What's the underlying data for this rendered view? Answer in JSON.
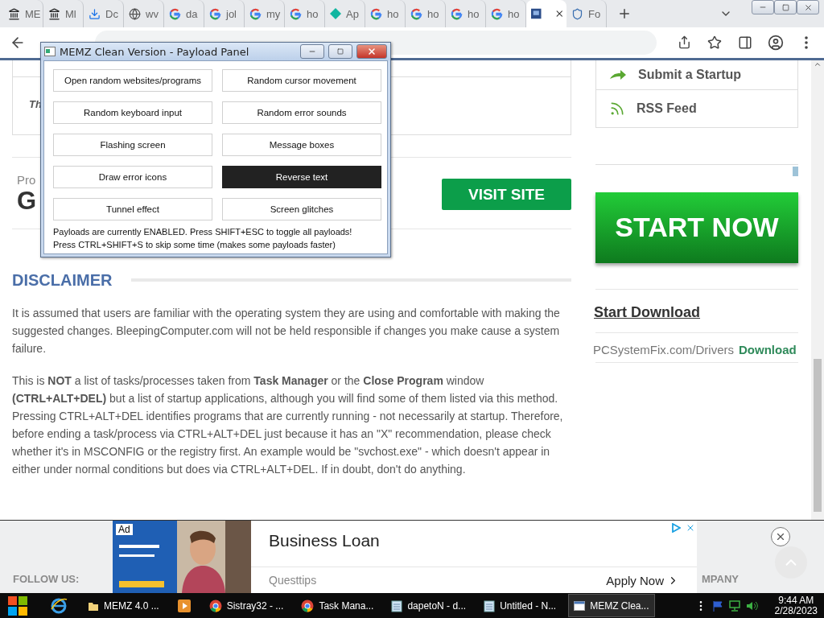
{
  "browser": {
    "tabs": [
      {
        "label": "ME",
        "kind": "museum",
        "selected": false
      },
      {
        "label": "Ml",
        "kind": "museum",
        "selected": false
      },
      {
        "label": "Dc",
        "kind": "download",
        "selected": false
      },
      {
        "label": "wv",
        "kind": "globe",
        "selected": false
      },
      {
        "label": "da",
        "kind": "google",
        "selected": false
      },
      {
        "label": "jol",
        "kind": "google",
        "selected": false
      },
      {
        "label": "my",
        "kind": "google",
        "selected": false
      },
      {
        "label": "ho",
        "kind": "google",
        "selected": false
      },
      {
        "label": "Ap",
        "kind": "diamond",
        "selected": false
      },
      {
        "label": "ho",
        "kind": "google",
        "selected": false
      },
      {
        "label": "ho",
        "kind": "google",
        "selected": false
      },
      {
        "label": "ho",
        "kind": "google",
        "selected": false
      },
      {
        "label": "ho",
        "kind": "google",
        "selected": false
      },
      {
        "kind": "page",
        "selected": true
      },
      {
        "label": "Fo",
        "kind": "shield",
        "selected": false
      }
    ]
  },
  "page": {
    "article_box": {
      "text": "Th"
    },
    "promo": {
      "label": "Pro",
      "title": "G",
      "button": "VISIT SITE"
    },
    "disclaimer": {
      "heading": "DISCLAIMER",
      "paragraphs": [
        "It is assumed that users are familiar with the operating system they are using and comfortable with making the suggested changes. BleepingComputer.com will not be held responsible if changes you make cause a system failure.",
        "This is **NOT** a list of tasks/processes taken from **Task Manager** or the **Close Program** window **(CTRL+ALT+DEL)** but a list of startup applications, although you will find some of them listed via this method. Pressing CTRL+ALT+DEL identifies programs that are currently running - not necessarily at startup. Therefore, before ending a task/process via CTRL+ALT+DEL just because it has an \"X\" recommendation, please check whether it's in MSCONFIG or the registry first. An example would be \"svchost.exe\" - which doesn't appear in either under normal conditions but does via CTRL+ALT+DEL. If in doubt, don't do anything."
      ]
    }
  },
  "sidebar": {
    "links": [
      {
        "label": "Submit a Startup",
        "kind": "arrow"
      },
      {
        "label": "RSS Feed",
        "kind": "rss"
      }
    ],
    "banner": "START NOW",
    "download_link": "Start Download",
    "ad_row": {
      "source": "PCSystemFix.com/Drivers",
      "action": "Download"
    }
  },
  "memz_window": {
    "title": "MEMZ Clean Version - Payload Panel",
    "payloads": [
      {
        "label": "Open random websites/programs",
        "selected": false
      },
      {
        "label": "Random cursor movement",
        "selected": false
      },
      {
        "label": "Random keyboard input",
        "selected": false
      },
      {
        "label": "Random error sounds",
        "selected": false
      },
      {
        "label": "Flashing screen",
        "selected": false
      },
      {
        "label": "Message boxes",
        "selected": false
      },
      {
        "label": "Draw error icons",
        "selected": false
      },
      {
        "label": "Reverse text",
        "selected": true
      },
      {
        "label": "Tunnel effect",
        "selected": false
      },
      {
        "label": "Screen glitches",
        "selected": false
      }
    ],
    "status": [
      "Payloads are currently ENABLED. Press SHIFT+ESC to toggle all payloads!",
      "Press CTRL+SHIFT+S to skip some time (makes some payloads faster)"
    ]
  },
  "footer": {
    "left": "FOLLOW US:",
    "right": "MPANY"
  },
  "ad": {
    "badge": "Ad",
    "title": "Business Loan",
    "advertiser": "Questtips",
    "action": "Apply Now"
  },
  "taskbar": {
    "items": [
      {
        "label": "MEMZ 4.0 ...",
        "kind": "folder",
        "selected": false
      },
      {
        "kind": "media",
        "selected": false
      },
      {
        "label": "Sistray32 - ...",
        "kind": "chrome",
        "selected": false
      },
      {
        "label": "Task Mana...",
        "kind": "chrome",
        "selected": false
      },
      {
        "label": "dapetoN - d...",
        "kind": "notepad",
        "selected": false
      },
      {
        "label": "Untitled - N...",
        "kind": "notepad",
        "selected": false
      },
      {
        "label": "MEMZ Clea...",
        "kind": "app",
        "selected": true
      }
    ],
    "time": "9:44 AM",
    "date": "2/28/2023"
  }
}
